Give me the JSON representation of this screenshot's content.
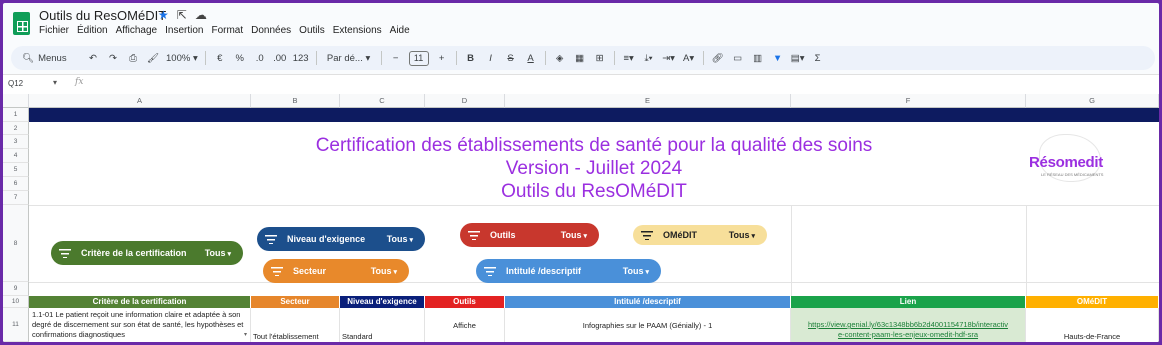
{
  "app": {
    "title": "Outils du ResOMéDIT",
    "menu": [
      "Fichier",
      "Édition",
      "Affichage",
      "Insertion",
      "Format",
      "Données",
      "Outils",
      "Extensions",
      "Aide"
    ]
  },
  "toolbar": {
    "menus_label": "Menus",
    "zoom": "100%",
    "currency": "€",
    "percent": "%",
    "dec_less": ".0",
    "dec_more": ".00",
    "number_fmt": "123",
    "font": "Par dé...",
    "font_size": "11",
    "bold": "B",
    "italic": "I",
    "sigma": "Σ"
  },
  "formula_bar": {
    "cell_ref": "Q12",
    "fx": "fx"
  },
  "columns": [
    "A",
    "B",
    "C",
    "D",
    "E",
    "F",
    "G"
  ],
  "rows": [
    "1",
    "2",
    "3",
    "4",
    "5",
    "6",
    "7",
    "8",
    "9",
    "10",
    "11"
  ],
  "sheet_title": {
    "line1": "Certification des établissements de santé pour la qualité des soins",
    "line2": "Version - Juillet 2024",
    "line3": "Outils du ResOMéDIT"
  },
  "logo": {
    "text": "Résomedit",
    "sub": "LE RÉSEAU DES MÉDICAMENTS"
  },
  "filters": [
    {
      "label": "Critère de la certification",
      "value": "Tous",
      "color": "#4b7a2d"
    },
    {
      "label": "Niveau d'exigence",
      "value": "Tous",
      "color": "#1c4f8c"
    },
    {
      "label": "Secteur",
      "value": "Tous",
      "color": "#e8892b"
    },
    {
      "label": "Outils",
      "value": "Tous",
      "color": "#c8372d"
    },
    {
      "label": "Intitulé /descriptif",
      "value": "Tous",
      "color": "#4a90d9"
    },
    {
      "label": "OMéDIT",
      "value": "Tous",
      "color": "#f7df9a"
    }
  ],
  "table": {
    "headers": [
      {
        "label": "Critère de la certification",
        "color": "#548235"
      },
      {
        "label": "Secteur",
        "color": "#e6862b"
      },
      {
        "label": "Niveau d'exigence",
        "color": "#0a1f7a"
      },
      {
        "label": "Outils",
        "color": "#e32222"
      },
      {
        "label": "Intitulé /descriptif",
        "color": "#4a90d9"
      },
      {
        "label": "Lien",
        "color": "#1aa34a"
      },
      {
        "label": "OMéDIT",
        "color": "#ffb000"
      }
    ],
    "row11": {
      "critere": "1.1-01 Le patient reçoit une information claire et adaptée à son degré de discernement sur son état de santé, les hypothèses et confirmations diagnostiques",
      "secteur": "Tout l'établissement",
      "niveau": "Standard",
      "outil": "Affiche",
      "intitule": "Infographies sur le PAAM (Génially) - 1",
      "lien": "https://view.genial.ly/63c1348bb6b2d400115471 8b/interactive-content-paam-les-enjeux-omedit-hdf-sra",
      "lien_line1": "https://view.genial.ly/63c1348bb6b2d4001154718b/interactiv",
      "lien_line2": "e-content-paam-les-enjeux-omedit-hdf-sra",
      "omedit": "Hauts-de-France"
    }
  }
}
